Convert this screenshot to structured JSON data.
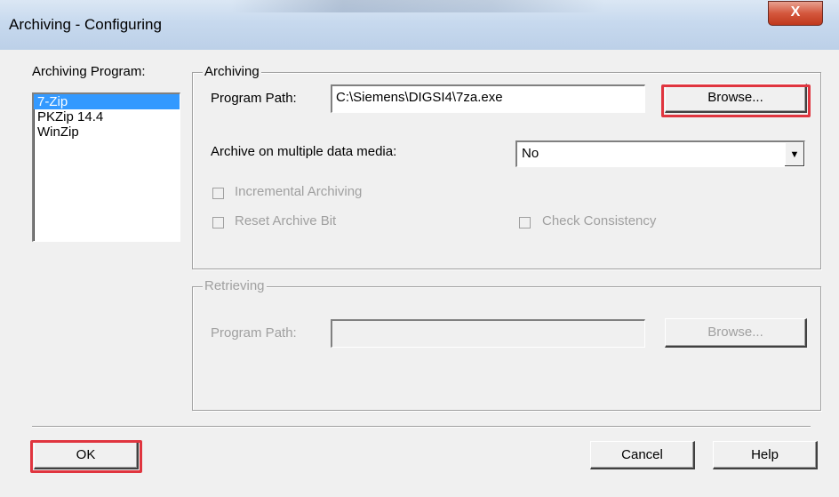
{
  "window": {
    "title": "Archiving - Configuring",
    "close_glyph": "X"
  },
  "program_list": {
    "label": "Archiving Program:",
    "items": [
      "7-Zip",
      "PKZip 14.4",
      "WinZip"
    ],
    "selected": "7-Zip"
  },
  "archiving": {
    "legend": "Archiving",
    "program_path_label": "Program Path:",
    "program_path_value": "C:\\Siemens\\DIGSI4\\7za.exe",
    "browse_label": "Browse...",
    "multi_media_label": "Archive on multiple data media:",
    "multi_media_value": "No",
    "incremental_label": "Incremental Archiving",
    "reset_bit_label": "Reset Archive Bit",
    "check_consistency_label": "Check Consistency"
  },
  "retrieving": {
    "legend": "Retrieving",
    "program_path_label": "Program Path:",
    "program_path_value": "",
    "browse_label": "Browse..."
  },
  "footer": {
    "ok_label": "OK",
    "cancel_label": "Cancel",
    "help_label": "Help"
  },
  "colors": {
    "highlight": "#e0353f",
    "selection": "#3399ff",
    "disabled_text": "#a0a0a0"
  }
}
